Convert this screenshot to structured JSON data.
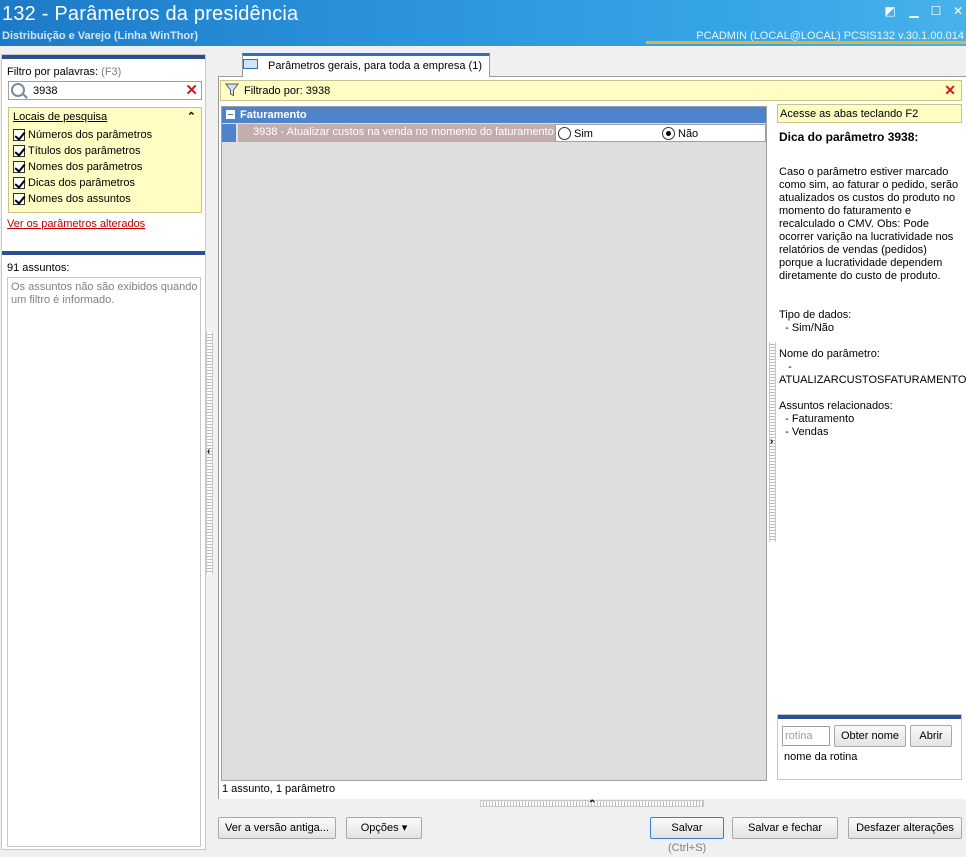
{
  "window": {
    "title": "132 - Parâmetros da presidência",
    "subtitle": "Distribuição e Varejo (Linha WinThor)",
    "user_info": "PCADMIN (LOCAL@LOCAL)   PCSIS132  v.30.1.00.014"
  },
  "filter": {
    "label": "Filtro por palavras:",
    "shortcut": "(F3)",
    "value": "3938"
  },
  "locais": {
    "title": "Locais de pesquisa",
    "items": [
      {
        "label": "Números dos parâmetros",
        "checked": true
      },
      {
        "label": "Títulos dos parâmetros",
        "checked": true
      },
      {
        "label": "Nomes dos parâmetros",
        "checked": true
      },
      {
        "label": "Dicas dos parâmetros",
        "checked": true
      },
      {
        "label": "Nomes dos assuntos",
        "checked": true
      }
    ]
  },
  "links": {
    "ver_alterados": "Ver os parâmetros alterados"
  },
  "assuntos": {
    "count_label": "91 assuntos:",
    "message": "Os assuntos não são exibidos quando um filtro é informado."
  },
  "tab": {
    "label": "Parâmetros gerais, para toda a empresa  (1)"
  },
  "filtered": {
    "text": "Filtrado por: 3938"
  },
  "grid": {
    "group": "Faturamento",
    "row": {
      "name": "3938 - Atualizar custos na venda no momento do faturamento",
      "option_sim": "Sim",
      "option_nao": "Não",
      "selected": "Não"
    }
  },
  "status": {
    "count": "1 assunto, 1 parâmetro"
  },
  "help": {
    "shortcut_hint": "Acesse as abas teclando F2",
    "title": "Dica do parâmetro 3938:",
    "body": "Caso o parâmetro estiver marcado como sim, ao faturar o pedido, serão atualizados os custos do produto no momento do faturamento e recalculado o CMV. Obs: Pode ocorrer varição na lucratividade nos relatórios de vendas (pedidos) porque a lucratividade dependem diretamente do custo de produto.",
    "tipo_label": "Tipo de dados:",
    "tipo_value": "  - Sim/Não",
    "nome_label": "Nome do parâmetro:",
    "nome_dash": "   -",
    "nome_value": "ATUALIZARCUSTOSFATURAMENTO",
    "assuntos_label": "Assuntos relacionados:",
    "assuntos_items": [
      "  - Faturamento",
      "  - Vendas"
    ]
  },
  "rotina": {
    "placeholder": "rotina",
    "obter_nome": "Obter nome",
    "abrir": "Abrir",
    "label": "nome da rotina"
  },
  "buttons": {
    "versao_antiga": "Ver a versão antiga...",
    "opcoes": "Opções ▾",
    "salvar": "Salvar",
    "salvar_shortcut": "(Ctrl+S)",
    "salvar_fechar": "Salvar e fechar",
    "desfazer": "Desfazer alterações"
  },
  "colors": {
    "title_bar": "#2b93dc",
    "group_header": "#4e84cc",
    "highlight_yellow": "#fffcc4",
    "accent_gold": "#e0b43c"
  }
}
